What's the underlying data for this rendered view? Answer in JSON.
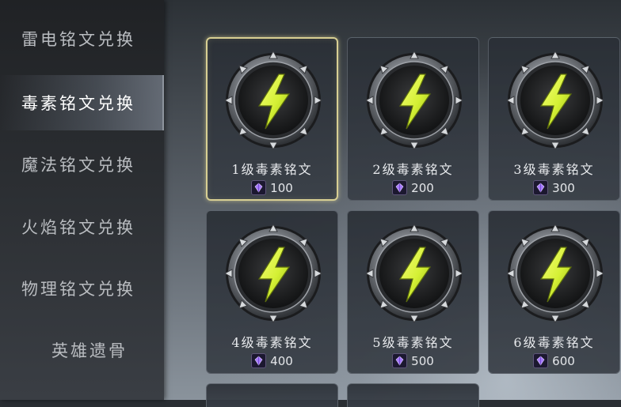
{
  "sidebar": {
    "items": [
      {
        "label": "雷电铭文兑换"
      },
      {
        "label": "毒素铭文兑换"
      },
      {
        "label": "魔法铭文兑换"
      },
      {
        "label": "火焰铭文兑换"
      },
      {
        "label": "物理铭文兑换"
      },
      {
        "label": "英雄遗骨"
      }
    ],
    "active_index": 1
  },
  "cards": [
    {
      "name": "1级毒素铭文",
      "price": "100",
      "icon": "lightning-rune-icon",
      "selected": true
    },
    {
      "name": "2级毒素铭文",
      "price": "200",
      "icon": "lightning-rune-icon"
    },
    {
      "name": "3级毒素铭文",
      "price": "300",
      "icon": "lightning-rune-icon"
    },
    {
      "name": "4级毒素铭文",
      "price": "400",
      "icon": "lightning-rune-icon"
    },
    {
      "name": "5级毒素铭文",
      "price": "500",
      "icon": "lightning-rune-icon"
    },
    {
      "name": "6级毒素铭文",
      "price": "600",
      "icon": "lightning-rune-icon"
    }
  ],
  "currency_icon": "purple-crystal-icon",
  "colors": {
    "accent_selected": "#d8cf93",
    "bolt": "#d4f034"
  }
}
